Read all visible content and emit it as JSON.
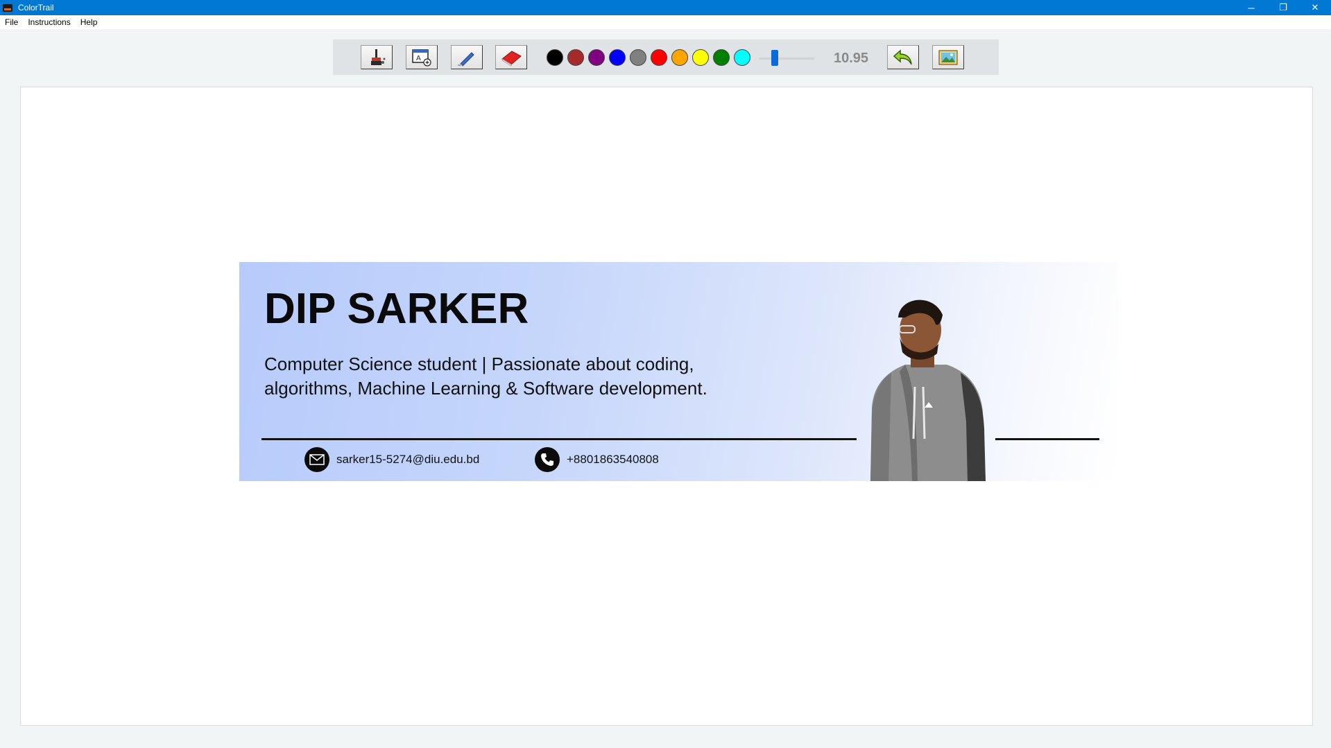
{
  "window": {
    "title": "ColorTrail",
    "minimize_glyph": "─",
    "maximize_glyph": "❐",
    "close_glyph": "✕"
  },
  "menu": {
    "items": [
      {
        "label": "File"
      },
      {
        "label": "Instructions"
      },
      {
        "label": "Help"
      }
    ]
  },
  "toolbar": {
    "tools": [
      {
        "name": "brush-tool",
        "icon": "brush-icon"
      },
      {
        "name": "text-tool",
        "icon": "text-box-icon"
      },
      {
        "name": "pencil-tool",
        "icon": "pencil-icon"
      },
      {
        "name": "eraser-tool",
        "icon": "eraser-icon"
      }
    ],
    "colors": [
      "#000000",
      "#a52a2a",
      "#800080",
      "#0000ff",
      "#808080",
      "#ff0000",
      "#ffa500",
      "#ffff00",
      "#008000",
      "#00ffff"
    ],
    "brush_size": "10.95",
    "undo_icon": "undo-arrow-icon",
    "open_image_icon": "image-icon",
    "accent_color": "#0a6bd8"
  },
  "banner": {
    "name": "DIP SARKER",
    "tagline_line1": "Computer Science student | Passionate about coding,",
    "tagline_line2": "algorithms, Machine Learning & Software development.",
    "email": "sarker15-5274@diu.edu.bd",
    "phone": "+8801863540808",
    "email_icon": "envelope-icon",
    "phone_icon": "phone-icon",
    "photo": "person-portrait-photo"
  }
}
